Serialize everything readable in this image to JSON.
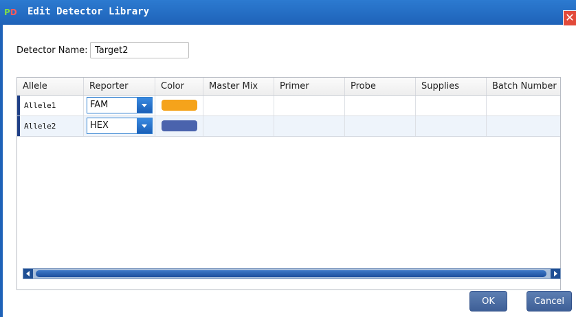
{
  "window": {
    "title": "Edit Detector Library",
    "app_icon_text": "PD"
  },
  "form": {
    "detector_name_label": "Detector Name:",
    "detector_name_value": "Target2"
  },
  "grid": {
    "columns": [
      "Allele",
      "Reporter",
      "Color",
      "Master Mix",
      "Primer",
      "Probe",
      "Supplies",
      "Batch Number"
    ],
    "rows": [
      {
        "allele": "Allele1",
        "reporter": "FAM",
        "color": "#f5a31b",
        "master_mix": "",
        "primer": "",
        "probe": "",
        "supplies": "",
        "batch_number": ""
      },
      {
        "allele": "Allele2",
        "reporter": "HEX",
        "color": "#4a63ad",
        "master_mix": "",
        "primer": "",
        "probe": "",
        "supplies": "",
        "batch_number": ""
      }
    ]
  },
  "buttons": {
    "ok": "OK",
    "cancel": "Cancel"
  },
  "icons": {
    "close": "close-icon",
    "dropdown": "chevron-down-icon",
    "scroll_left": "arrow-left-icon",
    "scroll_right": "arrow-right-icon"
  }
}
